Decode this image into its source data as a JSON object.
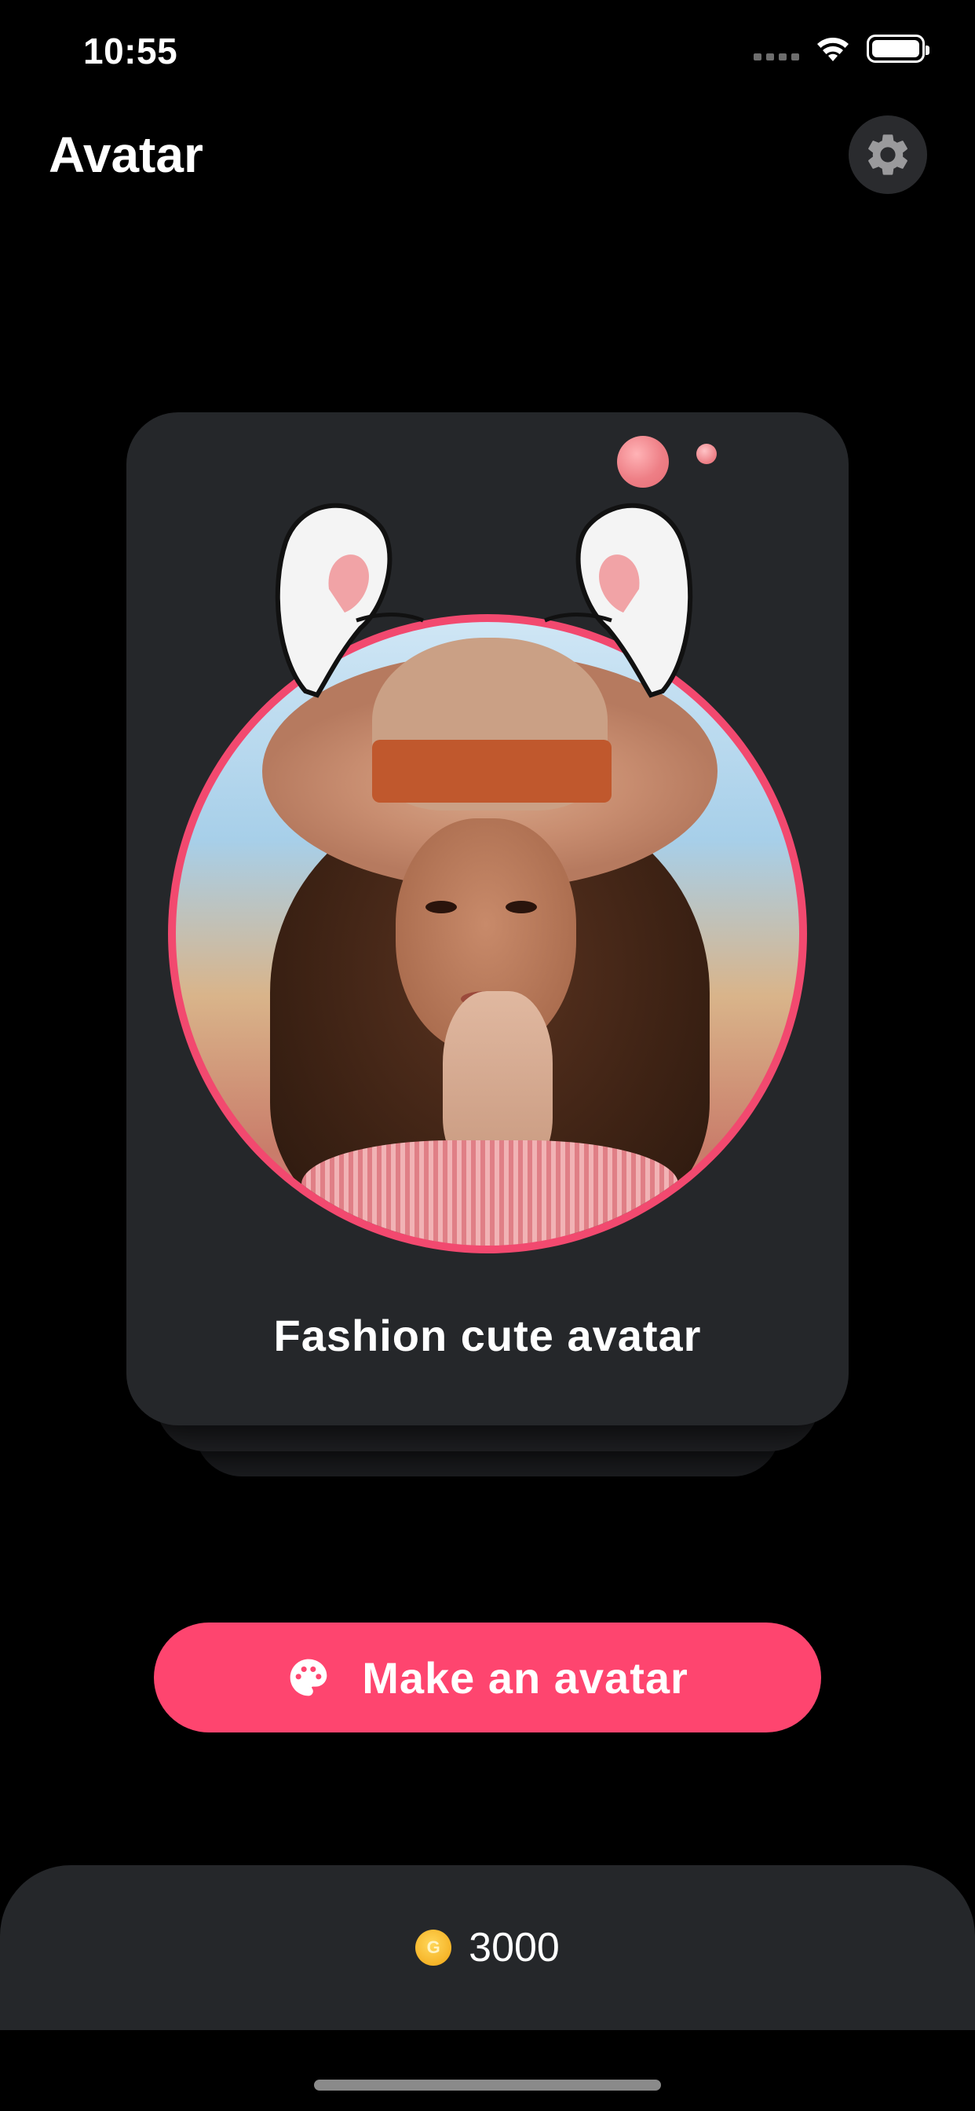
{
  "status_bar": {
    "time": "10:55"
  },
  "header": {
    "title": "Avatar",
    "settings_icon": "gear-icon"
  },
  "card": {
    "title": "Fashion cute avatar",
    "ring_color": "#f2496f",
    "decoration": "bunny-ears"
  },
  "make_button": {
    "label": "Make an avatar",
    "icon": "palette-icon",
    "color": "#fe456f"
  },
  "wallet": {
    "coin_letter": "G",
    "coin_count": "3000"
  },
  "colors": {
    "background": "#000000",
    "card": "#25272a",
    "accent": "#fe456f"
  }
}
